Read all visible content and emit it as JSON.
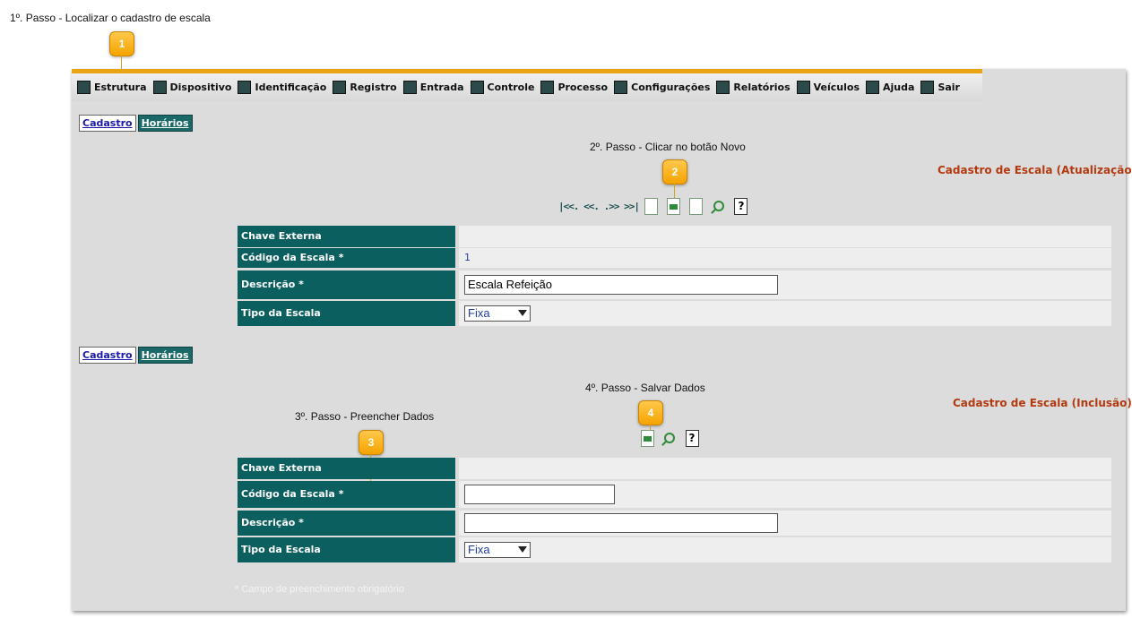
{
  "steps": {
    "step1": "1º. Passo - Localizar o cadastro de escala",
    "step2": "2º. Passo - Clicar no botão Novo",
    "step3": "3º. Passo - Preencher Dados",
    "step4": "4º. Passo - Salvar Dados"
  },
  "callouts": [
    "1",
    "2",
    "3",
    "4"
  ],
  "menu": [
    {
      "label": "Estrutura",
      "icon": "structure-icon"
    },
    {
      "label": "Dispositivo",
      "icon": "device-icon"
    },
    {
      "label": "Identificação",
      "icon": "identification-icon"
    },
    {
      "label": "Registro",
      "icon": "registry-icon"
    },
    {
      "label": "Entrada",
      "icon": "entry-icon"
    },
    {
      "label": "Controle",
      "icon": "control-icon"
    },
    {
      "label": "Processo",
      "icon": "process-icon"
    },
    {
      "label": "Configurações",
      "icon": "settings-icon"
    },
    {
      "label": "Relatórios",
      "icon": "reports-icon"
    },
    {
      "label": "Veículos",
      "icon": "vehicles-icon"
    },
    {
      "label": "Ajuda",
      "icon": "help-icon"
    },
    {
      "label": "Sair",
      "icon": "exit-icon"
    }
  ],
  "tabs": {
    "cadastro": "Cadastro",
    "horarios": "Horários"
  },
  "form1": {
    "title": "Cadastro de Escala (Atualização)",
    "labels": {
      "chave": "Chave Externa",
      "codigo": "Código da Escala *",
      "descricao": "Descrição *",
      "tipo": "Tipo da Escala"
    },
    "codigo_value": "1",
    "descricao_value": "Escala Refeição",
    "tipo_value": "Fixa"
  },
  "form2": {
    "title": "Cadastro de Escala (Inclusão)",
    "labels": {
      "chave": "Chave Externa",
      "codigo": "Código da Escala *",
      "descricao": "Descrição *",
      "tipo": "Tipo da Escala"
    },
    "codigo_value": "",
    "descricao_value": "",
    "tipo_value": "Fixa"
  },
  "nav_arrows": "|<<. <<. .>> >>|",
  "help_glyph": "?",
  "required_note": "* Campo de preenchimento obrigatório",
  "colors": {
    "accent": "#e8a516",
    "label_bg": "#0c5f5f",
    "title": "#b33a10",
    "panel": "#dcdcdc"
  }
}
